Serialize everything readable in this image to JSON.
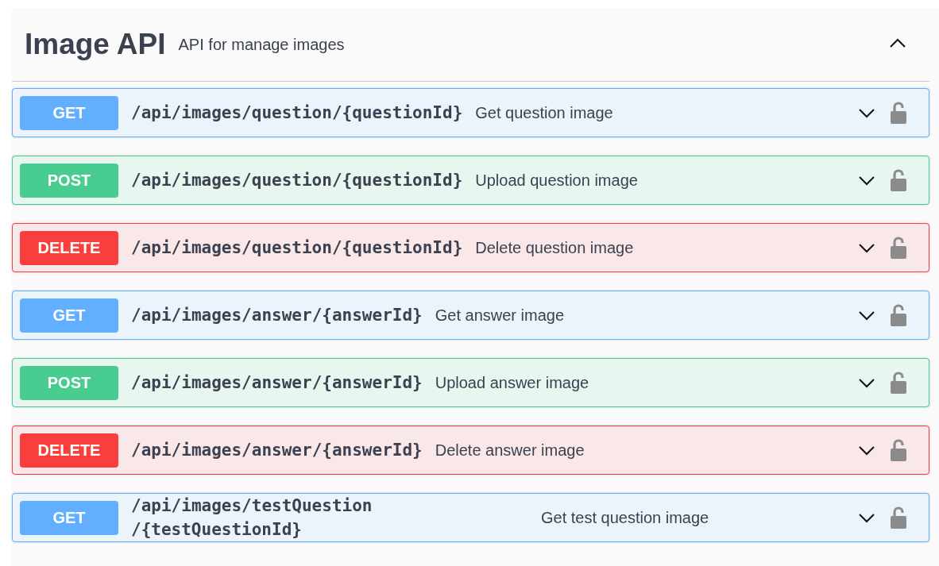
{
  "section": {
    "title": "Image API",
    "description": "API for manage images",
    "expanded": true
  },
  "operations": [
    {
      "kind": "get",
      "method": "GET",
      "path": "/api/images/question/{questionId}",
      "summary": "Get question image",
      "expanded": false,
      "locked": false
    },
    {
      "kind": "post",
      "method": "POST",
      "path": "/api/images/question/{questionId}",
      "summary": "Upload question image",
      "expanded": false,
      "locked": false
    },
    {
      "kind": "delete",
      "method": "DELETE",
      "path": "/api/images/question/{questionId}",
      "summary": "Delete question image",
      "expanded": false,
      "locked": false
    },
    {
      "kind": "get",
      "method": "GET",
      "path": "/api/images/answer/{answerId}",
      "summary": "Get answer image",
      "expanded": false,
      "locked": false
    },
    {
      "kind": "post",
      "method": "POST",
      "path": "/api/images/answer/{answerId}",
      "summary": "Upload answer image",
      "expanded": false,
      "locked": false
    },
    {
      "kind": "delete",
      "method": "DELETE",
      "path": "/api/images/answer/{answerId}",
      "summary": "Delete answer image",
      "expanded": false,
      "locked": false
    },
    {
      "kind": "get",
      "method": "GET",
      "path": "/api/images/testQuestion/{testQuestionId}",
      "summary": "Get test question image",
      "expanded": false,
      "locked": false
    }
  ]
}
